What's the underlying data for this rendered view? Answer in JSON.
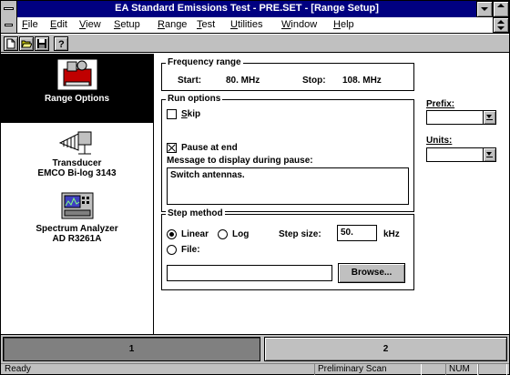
{
  "window": {
    "title": "EA Standard Emissions Test - PRE.SET - [Range Setup]"
  },
  "menubar": {
    "items": [
      {
        "label": "File",
        "accel": "F"
      },
      {
        "label": "Edit",
        "accel": "E"
      },
      {
        "label": "View",
        "accel": "V"
      },
      {
        "label": "Setup",
        "accel": "S"
      },
      {
        "label": "Range",
        "accel": "R"
      },
      {
        "label": "Test",
        "accel": "T"
      },
      {
        "label": "Utilities",
        "accel": "U"
      },
      {
        "label": "Window",
        "accel": "W"
      },
      {
        "label": "Help",
        "accel": "H"
      }
    ]
  },
  "toolbar": {
    "icons": [
      "new-file-icon",
      "open-folder-icon",
      "save-disk-icon",
      "help-question-icon"
    ]
  },
  "left_panel": {
    "items": [
      {
        "label_line1": "Range Options",
        "label_line2": "",
        "icon": "range-options-icon",
        "selected": true
      },
      {
        "label_line1": "Transducer",
        "label_line2": "EMCO Bi-log 3143",
        "icon": "antenna-icon",
        "selected": false
      },
      {
        "label_line1": "Spectrum Analyzer",
        "label_line2": "AD R3261A",
        "icon": "spectrum-analyzer-icon",
        "selected": false
      }
    ]
  },
  "frequency_range": {
    "title": "Frequency range",
    "start_label": "Start:",
    "start_value": "80. MHz",
    "stop_label": "Stop:",
    "stop_value": "108. MHz"
  },
  "run_options": {
    "title": "Run options",
    "skip_label": "Skip",
    "skip_checked": false,
    "pause_label": "Pause at end",
    "pause_checked": true,
    "message_label": "Message to display during pause:",
    "message_value": "Switch antennas."
  },
  "step_method": {
    "title": "Step method",
    "linear_label": "Linear",
    "linear_selected": true,
    "log_label": "Log",
    "log_selected": false,
    "step_size_label": "Step size:",
    "step_size_value": "50.",
    "step_unit": "kHz",
    "file_label": "File:",
    "file_selected": false,
    "file_value": "",
    "browse_label": "Browse..."
  },
  "right_fields": {
    "prefix_label": "Prefix:",
    "prefix_value": "",
    "units_label": "Units:",
    "units_value": ""
  },
  "bottom_tabs": [
    {
      "label": "1",
      "active": true
    },
    {
      "label": "2",
      "active": false
    }
  ],
  "statusbar": {
    "status": "Ready",
    "mode": "Preliminary Scan",
    "num": "NUM"
  },
  "colors": {
    "titlebar": "#000080",
    "face": "#c0c0c0",
    "selected_bg": "#000000"
  }
}
